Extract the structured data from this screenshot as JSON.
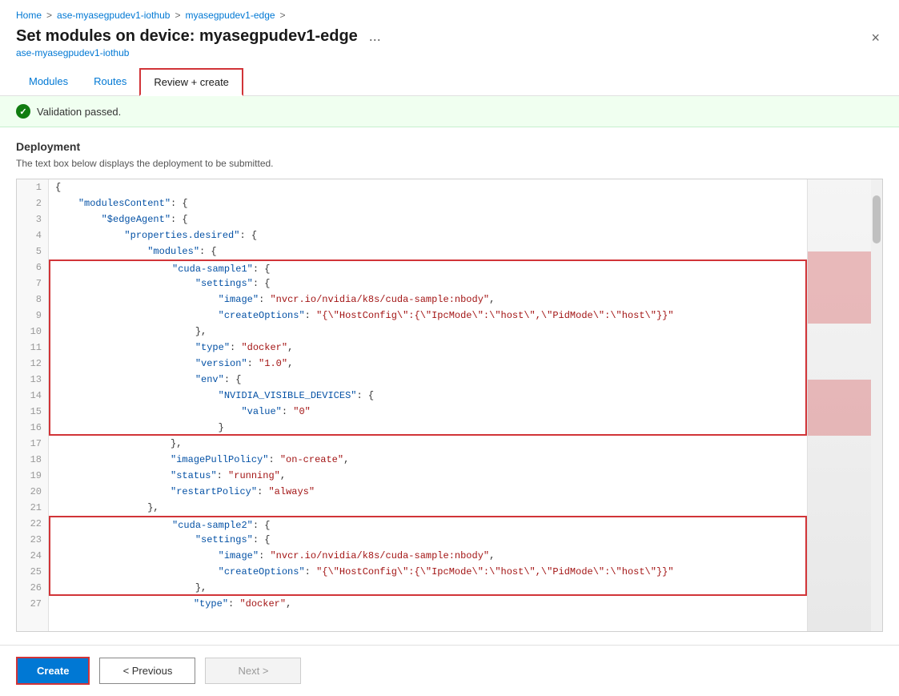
{
  "breadcrumb": {
    "items": [
      "Home",
      "ase-myasegpudev1-iothub",
      "myasegpudev1-edge"
    ],
    "separators": [
      ">",
      ">",
      ">"
    ]
  },
  "header": {
    "title": "Set modules on device: myasegpudev1-edge",
    "subtitle": "ase-myasegpudev1-iothub",
    "ellipsis_label": "...",
    "close_label": "×"
  },
  "tabs": [
    {
      "id": "modules",
      "label": "Modules",
      "active": false
    },
    {
      "id": "routes",
      "label": "Routes",
      "active": false
    },
    {
      "id": "review-create",
      "label": "Review + create",
      "active": true
    }
  ],
  "validation": {
    "text": "Validation passed."
  },
  "deployment": {
    "title": "Deployment",
    "description": "The text box below displays the deployment to be submitted."
  },
  "code_lines": [
    {
      "num": 1,
      "text": "{",
      "highlight": false
    },
    {
      "num": 2,
      "text": "    \"modulesContent\": {",
      "highlight": false
    },
    {
      "num": 3,
      "text": "        \"$edgeAgent\": {",
      "highlight": false
    },
    {
      "num": 4,
      "text": "            \"properties.desired\": {",
      "highlight": false
    },
    {
      "num": 5,
      "text": "                \"modules\": {",
      "highlight": false
    },
    {
      "num": 6,
      "text": "                    \"cuda-sample1\": {",
      "highlight": true
    },
    {
      "num": 7,
      "text": "                        \"settings\": {",
      "highlight": true
    },
    {
      "num": 8,
      "text": "                            \"image\": \"nvcr.io/nvidia/k8s/cuda-sample:nbody\",",
      "highlight": true
    },
    {
      "num": 9,
      "text": "                            \"createOptions\": \"{\\\"HostConfig\\\":{\\\"IpcMode\\\":\\\"host\\\",\\\"PidMode\\\":\\\"host\\\"}}\"",
      "highlight": true
    },
    {
      "num": 10,
      "text": "                        },",
      "highlight": true
    },
    {
      "num": 11,
      "text": "                        \"type\": \"docker\",",
      "highlight": true
    },
    {
      "num": 12,
      "text": "                        \"version\": \"1.0\",",
      "highlight": true
    },
    {
      "num": 13,
      "text": "                        \"env\": {",
      "highlight": true
    },
    {
      "num": 14,
      "text": "                            \"NVIDIA_VISIBLE_DEVICES\": {",
      "highlight": true
    },
    {
      "num": 15,
      "text": "                                \"value\": \"0\"",
      "highlight": true
    },
    {
      "num": 16,
      "text": "                            }",
      "highlight": true
    },
    {
      "num": 17,
      "text": "                    },",
      "highlight": false
    },
    {
      "num": 18,
      "text": "                    \"imagePullPolicy\": \"on-create\",",
      "highlight": false
    },
    {
      "num": 19,
      "text": "                    \"status\": \"running\",",
      "highlight": false
    },
    {
      "num": 20,
      "text": "                    \"restartPolicy\": \"always\"",
      "highlight": false
    },
    {
      "num": 21,
      "text": "                },",
      "highlight": false
    },
    {
      "num": 22,
      "text": "                    \"cuda-sample2\": {",
      "highlight": true
    },
    {
      "num": 23,
      "text": "                        \"settings\": {",
      "highlight": true
    },
    {
      "num": 24,
      "text": "                            \"image\": \"nvcr.io/nvidia/k8s/cuda-sample:nbody\",",
      "highlight": true
    },
    {
      "num": 25,
      "text": "                            \"createOptions\": \"{\\\"HostConfig\\\":{\\\"IpcMode\\\":\\\"host\\\",\\\"PidMode\\\":\\\"host\\\"}}\"",
      "highlight": true
    },
    {
      "num": 26,
      "text": "                        },",
      "highlight": true
    },
    {
      "num": 27,
      "text": "                        \"type\": \"docker\",",
      "highlight": false
    }
  ],
  "footer": {
    "create_label": "Create",
    "prev_label": "< Previous",
    "next_label": "Next >"
  }
}
